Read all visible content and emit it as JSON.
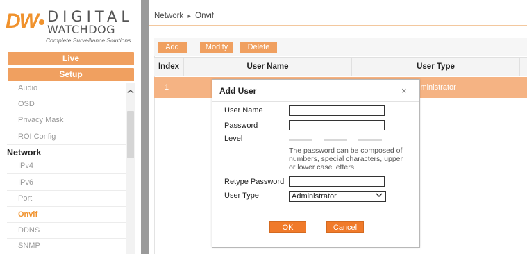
{
  "brand": {
    "logo_mark": "DW",
    "logo_line1": "DIGITAL",
    "logo_line2": "WATCHDOG",
    "tagline": "Complete Surveillance Solutions",
    "accent_color": "#f0922d"
  },
  "sidebar": {
    "live_label": "Live",
    "setup_label": "Setup",
    "items": [
      {
        "label": "Audio"
      },
      {
        "label": "OSD"
      },
      {
        "label": "Privacy Mask"
      },
      {
        "label": "ROI Config"
      }
    ],
    "group_label": "Network",
    "network_items": [
      {
        "label": "IPv4"
      },
      {
        "label": "IPv6"
      },
      {
        "label": "Port"
      },
      {
        "label": "Onvif"
      },
      {
        "label": "DDNS"
      },
      {
        "label": "SNMP"
      }
    ]
  },
  "breadcrumb": {
    "part1": "Network",
    "separator": "▸",
    "part2": "Onvif"
  },
  "toolbar": {
    "add_label": "Add",
    "modify_label": "Modify",
    "delete_label": "Delete"
  },
  "table": {
    "columns": [
      "Index",
      "User Name",
      "User Type"
    ],
    "rows": [
      {
        "index": "1",
        "user_name": "",
        "user_type": "Administrator"
      }
    ]
  },
  "dialog": {
    "title": "Add User",
    "close_glyph": "×",
    "user_name_label": "User Name",
    "user_name_value": "",
    "password_label": "Password",
    "password_value": "",
    "level_label": "Level",
    "hint": "The password can be composed of numbers, special characters, upper or lower case letters.",
    "retype_label": "Retype Password",
    "retype_value": "",
    "user_type_label": "User Type",
    "user_type_value": "Administrator",
    "ok_label": "OK",
    "cancel_label": "Cancel"
  },
  "icons": {
    "scroll_up": "chevron-up-icon",
    "select_arrow": "chevron-down-icon",
    "close": "close-icon"
  }
}
